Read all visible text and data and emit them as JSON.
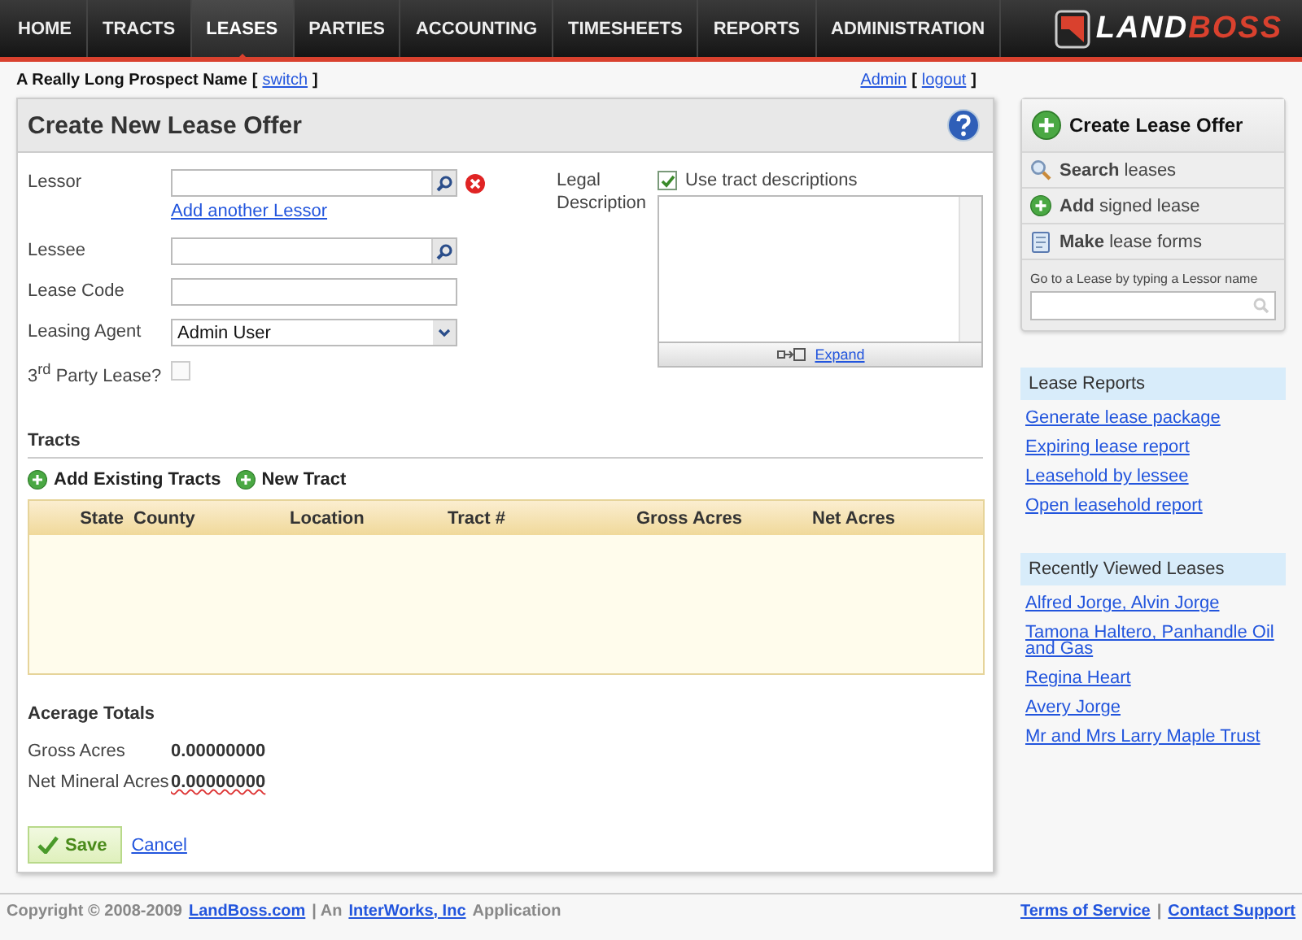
{
  "nav": {
    "items": [
      {
        "label": "HOME",
        "selected": false
      },
      {
        "label": "TRACTS",
        "selected": false
      },
      {
        "label": "LEASES",
        "selected": true
      },
      {
        "label": "PARTIES",
        "selected": false
      },
      {
        "label": "ACCOUNTING",
        "selected": false
      },
      {
        "label": "TIMESHEETS",
        "selected": false
      },
      {
        "label": "REPORTS",
        "selected": false
      },
      {
        "label": "ADMINISTRATION",
        "selected": false
      }
    ],
    "logo": {
      "part_1": "LAND",
      "part_2": "BOSS"
    }
  },
  "prospect_bar": {
    "name": "A Really Long Prospect Name",
    "switch_open": "[",
    "switch_link": "switch",
    "switch_close": "]",
    "user_link": "Admin",
    "logout_open": "[",
    "logout_link": "logout",
    "logout_close": "]"
  },
  "form": {
    "title": "Create New Lease Offer",
    "fields": [
      {
        "kind": "lookup",
        "label": "Lessor",
        "removable": true,
        "link": "Add another Lessor"
      },
      {
        "kind": "lookup",
        "label": "Lessee",
        "removable": false
      },
      {
        "kind": "text",
        "label": "Lease Code"
      },
      {
        "kind": "select",
        "label": "Leasing Agent",
        "value": "Admin User"
      },
      {
        "kind": "checkbox",
        "label": "3$^{rd}$ Party Lease?",
        "checked": false
      }
    ],
    "legal": {
      "label": "Legal Description",
      "checkbox_label": "Use tract descriptions",
      "checked": true,
      "expand_link": "Expand"
    },
    "tracts": {
      "title": "Tracts",
      "actions": [
        "Add Existing Tracts",
        "New Tract"
      ],
      "columns": [
        "State",
        "County",
        "Location",
        "Tract #",
        "Gross Acres",
        "Net Acres"
      ]
    },
    "totals": {
      "title": "Acerage Totals",
      "rows": [
        {
          "label": "Gross Acres",
          "value": "0.00000000",
          "misspelled": false
        },
        {
          "label": "Net Mineral Acres",
          "value": "0.00000000",
          "misspelled": true
        }
      ]
    },
    "save": "Save",
    "cancel": "Cancel"
  },
  "sidebar": {
    "primary": "Create Lease Offer",
    "actions": [
      {
        "kind": "search",
        "label": "**Search** leases"
      },
      {
        "kind": "add",
        "label": "**Add** signed lease"
      },
      {
        "kind": "forms",
        "label": "**Make** lease forms"
      }
    ],
    "goto_label": "Go to a Lease by typing a Lessor name",
    "sections": [
      {
        "title": "Lease Reports",
        "links": [
          "Generate lease package",
          "Expiring lease report",
          "Leasehold by lessee",
          "Open leasehold report"
        ]
      },
      {
        "title": "Recently Viewed Leases",
        "links": [
          "Alfred Jorge, Alvin Jorge",
          "Tamona Haltero, Panhandle Oil and Gas",
          "Regina Heart",
          "Avery Jorge",
          "Mr and Mrs Larry Maple Trust"
        ]
      }
    ]
  },
  "footer": {
    "left": [
      {
        "kind": "text",
        "text": "Copyright © 2008-2009"
      },
      {
        "kind": "link",
        "text": "LandBoss.com"
      },
      {
        "kind": "text",
        "text": "| An"
      },
      {
        "kind": "link",
        "text": "InterWorks, Inc"
      },
      {
        "kind": "text",
        "text": "Application"
      }
    ],
    "right": [
      {
        "kind": "link",
        "text": "Terms of Service"
      },
      {
        "kind": "text",
        "text": "|"
      },
      {
        "kind": "link",
        "text": "Contact Support"
      }
    ]
  }
}
